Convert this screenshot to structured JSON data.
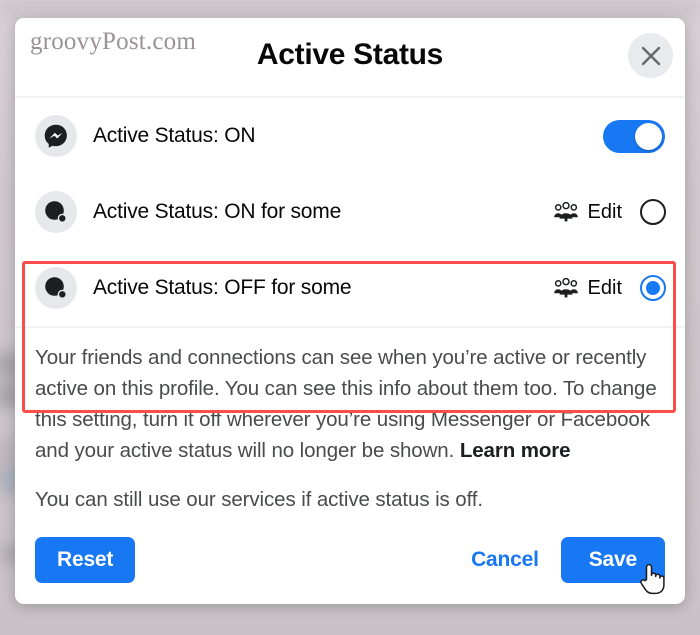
{
  "watermark": "groovyPost.com",
  "header": {
    "title": "Active Status",
    "close_icon": "close-icon"
  },
  "options": [
    {
      "icon": "messenger-logo-icon",
      "label": "Active Status: ON",
      "control": "toggle",
      "toggle_on": true,
      "edit_label": null,
      "highlighted": false
    },
    {
      "icon": "active-status-dot-icon",
      "label": "Active Status: ON for some",
      "control": "radio",
      "selected": false,
      "edit_label": "Edit",
      "edit_icon": "group-people-icon",
      "highlighted": true
    },
    {
      "icon": "active-status-dot-icon",
      "label": "Active Status: OFF for some",
      "control": "radio",
      "selected": true,
      "edit_label": "Edit",
      "edit_icon": "group-people-icon",
      "highlighted": true
    }
  ],
  "body": {
    "paragraph": "Your friends and connections can see when you’re active or recently active on this profile. You can see this info about them too. To change this setting, turn it off wherever you’re using Messenger or Facebook and your active status will no longer be shown. ",
    "learn_more": "Learn more",
    "note": "You can still use our services if active status is off."
  },
  "footer": {
    "reset_label": "Reset",
    "cancel_label": "Cancel",
    "save_label": "Save"
  },
  "colors": {
    "accent": "#1877f2",
    "highlight": "#fb4d4a",
    "text": "#080809",
    "muted": "#4a4b4c",
    "divider": "#f0f2f5",
    "avatar_bg": "#e6e8ec"
  }
}
